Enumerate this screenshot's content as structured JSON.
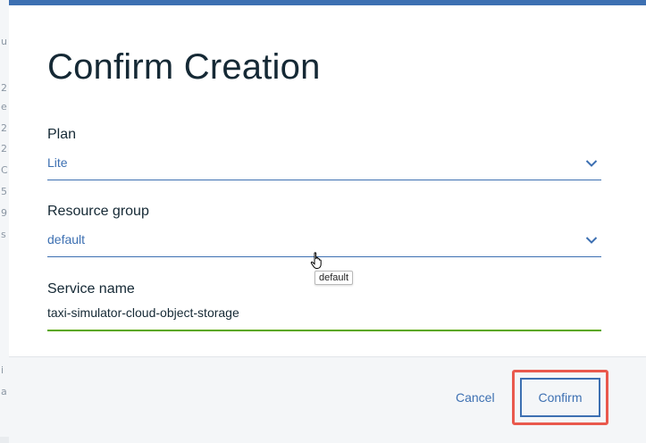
{
  "dialog": {
    "title": "Confirm Creation",
    "plan": {
      "label": "Plan",
      "value": "Lite"
    },
    "resource_group": {
      "label": "Resource group",
      "value": "default",
      "tooltip": "default"
    },
    "service_name": {
      "label": "Service name",
      "value": "taxi-simulator-cloud-object-storage"
    },
    "footer": {
      "cancel_label": "Cancel",
      "confirm_label": "Confirm"
    }
  },
  "backdrop": {
    "fragments": [
      "u",
      "2",
      "e",
      "2",
      "2",
      "C",
      "5",
      "9",
      "s",
      "i",
      "a"
    ]
  },
  "colors": {
    "accent": "#3d70b2",
    "title": "#152935",
    "input_underline_valid": "#5aa700",
    "highlight": "#e9594d"
  }
}
